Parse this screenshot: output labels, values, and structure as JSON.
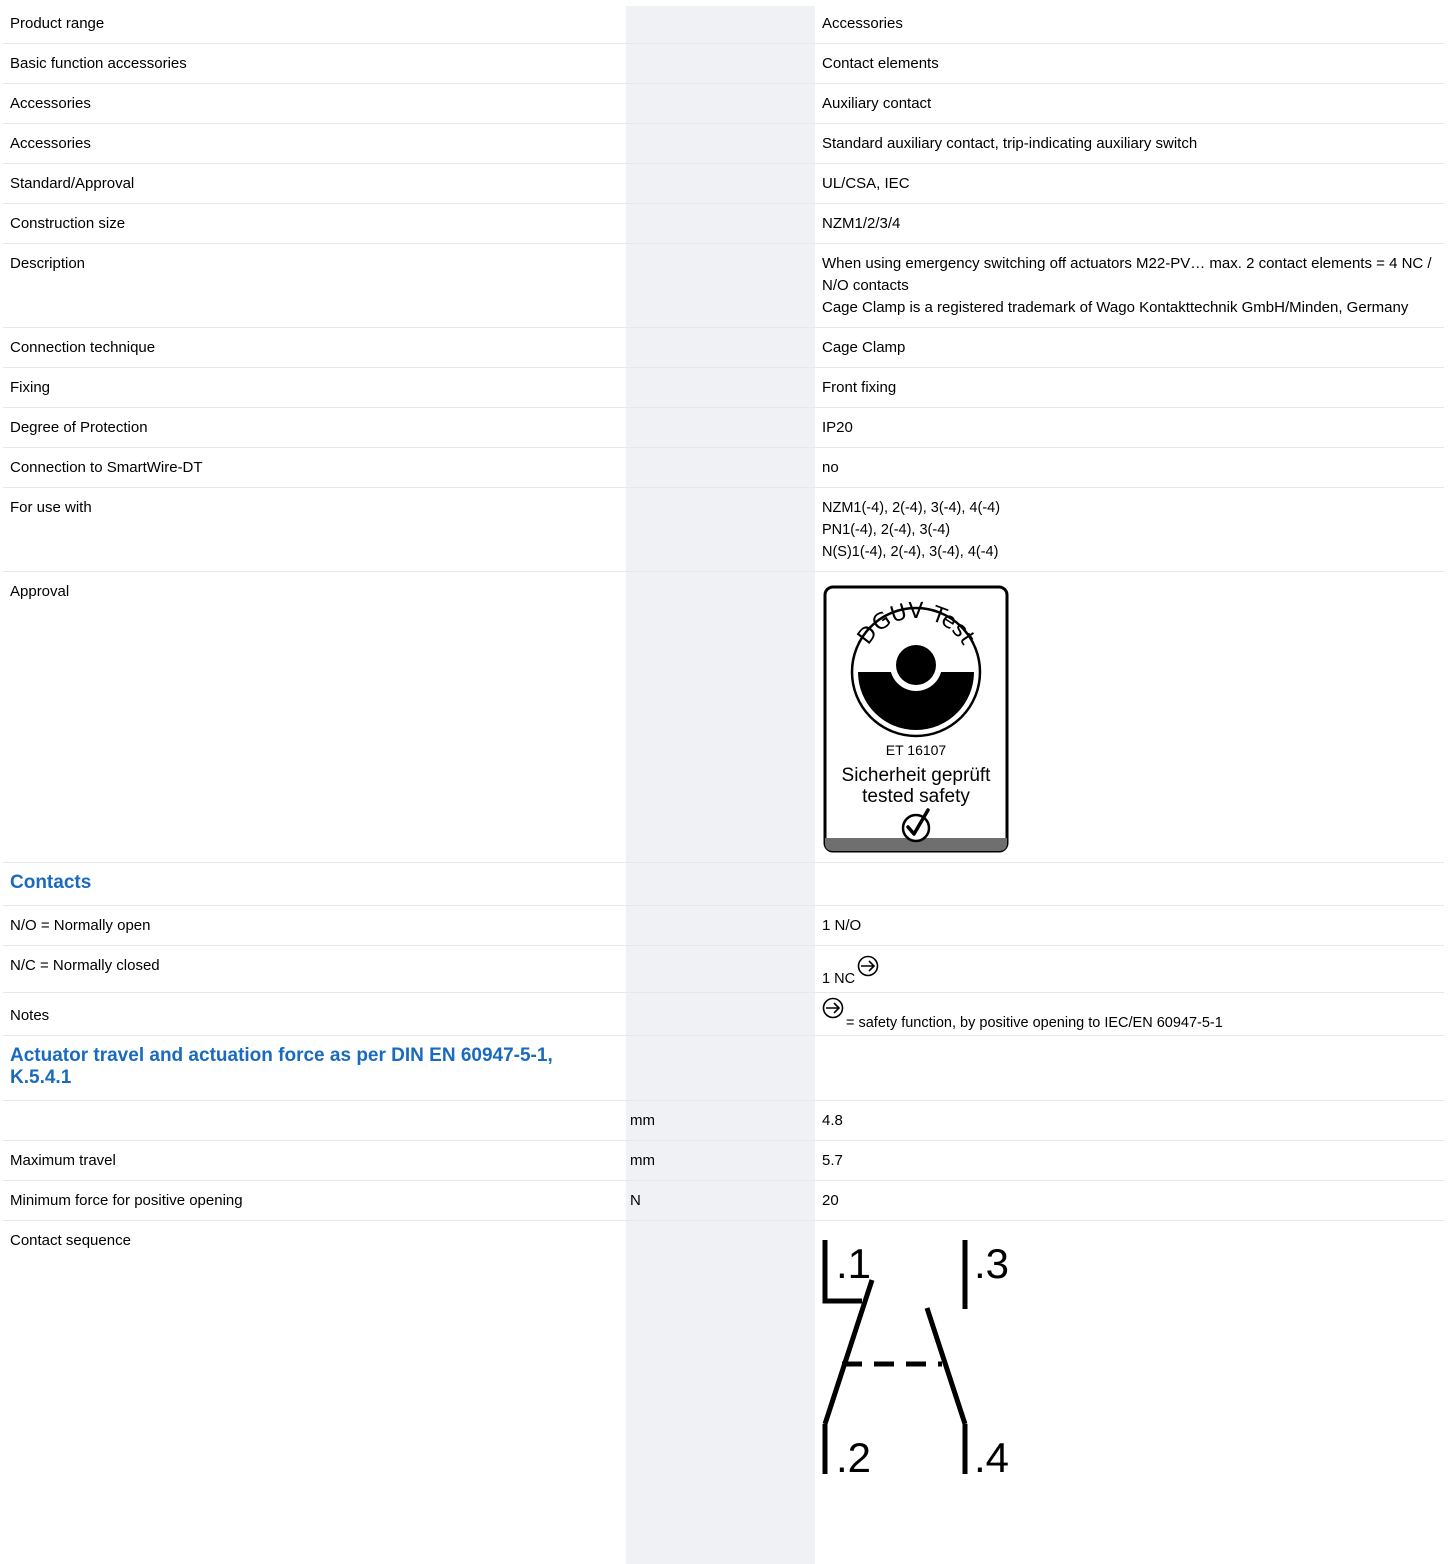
{
  "rows": [
    {
      "label": "Product range",
      "value": "Accessories"
    },
    {
      "label": "Basic function accessories",
      "value": "Contact elements"
    },
    {
      "label": "Accessories",
      "value": "Auxiliary contact"
    },
    {
      "label": "Accessories",
      "value": "Standard auxiliary contact, trip-indicating auxiliary switch"
    },
    {
      "label": "Standard/Approval",
      "value": "UL/CSA, IEC"
    },
    {
      "label": "Construction size",
      "value": "NZM1/2/3/4"
    },
    {
      "label": "Description",
      "value": "When using emergency switching off actuators M22-PV… max. 2 contact elements = 4 NC / N/O contacts\nCage Clamp is a registered trademark of Wago Kontakttechnik GmbH/Minden, Germany"
    },
    {
      "label": "Connection technique",
      "value": "Cage Clamp"
    },
    {
      "label": "Fixing",
      "value": "Front fixing"
    },
    {
      "label": "Degree of Protection",
      "value": "IP20"
    },
    {
      "label": "Connection to SmartWire-DT",
      "value": "no"
    },
    {
      "label": "For use with",
      "value": "NZM1(-4), 2(-4), 3(-4), 4(-4)\nPN1(-4), 2(-4), 3(-4)\nN(S)1(-4), 2(-4), 3(-4), 4(-4)"
    },
    {
      "label": "Approval",
      "value": ""
    }
  ],
  "approval_badge": {
    "logo_text": "DGUV Test",
    "id": "ET 16107",
    "line1": "Sicherheit geprüft",
    "line2": "tested safety"
  },
  "contacts": {
    "heading": "Contacts",
    "no_label": "N/O = Normally open",
    "no_value": "1 N/O",
    "nc_label": "N/C = Normally closed",
    "nc_value": "1 NC",
    "notes_label": "Notes",
    "notes_value": "= safety function, by positive opening to IEC/EN 60947-5-1"
  },
  "actuator": {
    "heading": "Actuator travel and actuation force as per DIN EN 60947-5-1, K.5.4.1",
    "rows": [
      {
        "label": "",
        "unit": "mm",
        "value": "4.8"
      },
      {
        "label": "Maximum travel",
        "unit": "mm",
        "value": "5.7"
      },
      {
        "label": "Minimum force for positive opening",
        "unit": "N",
        "value": "20"
      }
    ]
  },
  "sequence": {
    "label": "Contact sequence",
    "t1": ".1",
    "t2": ".2",
    "t3": ".3",
    "t4": ".4"
  }
}
